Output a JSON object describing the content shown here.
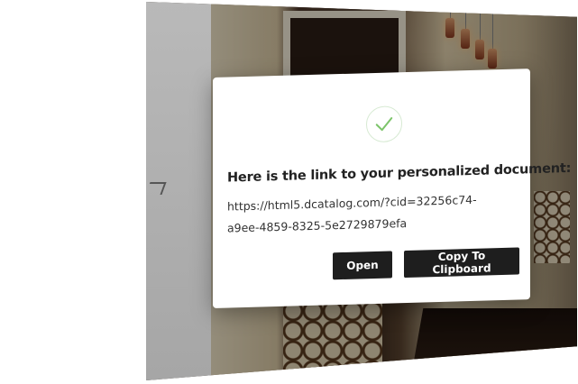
{
  "modal": {
    "icon": "checkmark-circle-icon",
    "title": "Here is the link to your personalized document:",
    "link_line1": "https://html5.dcatalog.com/?cid=32256c74-",
    "link_line2": "a9ee-4859-8325-5e2729879efa",
    "open_label": "Open",
    "copy_label": "Copy To Clipboard"
  },
  "colors": {
    "check": "#7cc46a",
    "button_bg": "#1e1e1e",
    "button_text": "#ffffff"
  }
}
